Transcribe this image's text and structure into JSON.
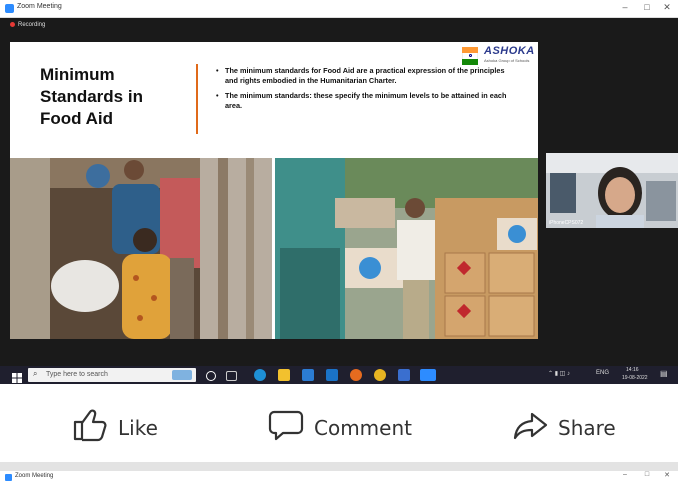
{
  "window": {
    "title": "Zoom Meeting",
    "controls": [
      "–",
      "□",
      "✕"
    ]
  },
  "recording_label": "Recording",
  "slide": {
    "title": "Minimum\nStandards in\nFood Aid",
    "bullets": [
      "The minimum standards for Food Aid are a practical expression of the principles and rights embodied in the Humanitarian Charter.",
      "The minimum standards: these specify the minimum levels to be attained in each area."
    ],
    "logo": "ASHOKA",
    "logo_subtitle": "Ashoka Group of Schools",
    "flag_colors": [
      "#ff9933",
      "#ffffff",
      "#138808"
    ]
  },
  "participant": {
    "name": "iPhoneCPS072"
  },
  "taskbar": {
    "search_placeholder": "Type here to search",
    "language": "ENG",
    "time": "14:16",
    "date": "19-08-2022"
  },
  "social": {
    "like": "Like",
    "comment": "Comment",
    "share": "Share"
  },
  "window2": {
    "title": "Zoom Meeting"
  },
  "colors": {
    "accent": "#e06a1a",
    "zoom_blue": "#2d8cff",
    "taskbar": "#1f1f2e"
  }
}
